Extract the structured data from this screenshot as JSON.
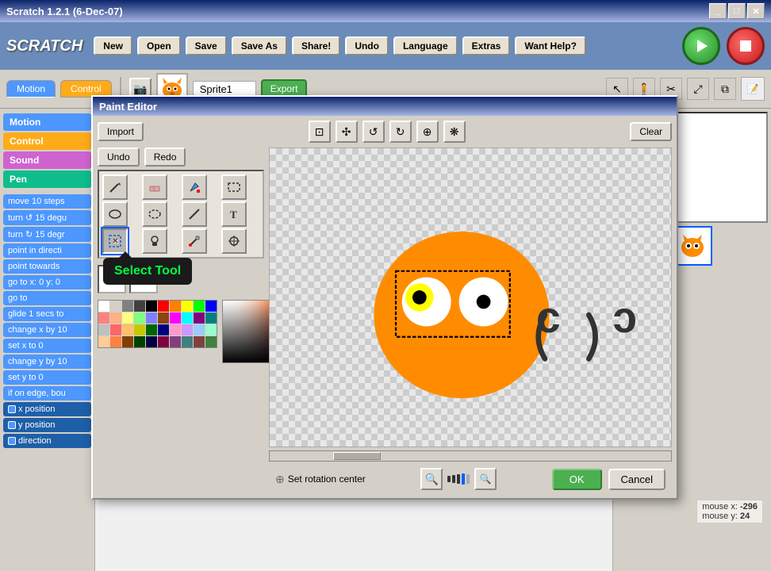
{
  "window": {
    "title": "Scratch 1.2.1 (6-Dec-07)",
    "controls": [
      "minimize",
      "maximize",
      "close"
    ]
  },
  "toolbar": {
    "logo": "SCRATCH",
    "buttons": [
      "New",
      "Open",
      "Save",
      "Save As",
      "Share!",
      "Undo",
      "Language",
      "Extras",
      "Want Help?"
    ]
  },
  "tabs": {
    "motion": "Motion",
    "control": "Control"
  },
  "sprite": {
    "name": "Sprite1",
    "export_label": "Export"
  },
  "categories": [
    "Motion",
    "Control",
    "Sound",
    "Pen"
  ],
  "blocks": [
    "move 10 steps",
    "turn ↺ 15 degu",
    "turn ↻ 15 degr",
    "point in directi",
    "point towards",
    "go to x: 0 y: 0",
    "go to",
    "glide 1 secs to",
    "change x by 10",
    "set x to 0",
    "change y by 10",
    "set y to 0",
    "if on edge, bou",
    "x position",
    "y position",
    "direction"
  ],
  "paint_editor": {
    "title": "Paint Editor",
    "import_btn": "Import",
    "undo_btn": "Undo",
    "redo_btn": "Redo",
    "clear_btn": "Clear",
    "ok_btn": "OK",
    "cancel_btn": "Cancel",
    "set_rotation_center": "Set rotation center",
    "tooltip": "Select Tool",
    "tools": [
      "pencil",
      "eraser",
      "fill",
      "rect-select",
      "ellipse",
      "select",
      "line",
      "text",
      "marquee",
      "stamp",
      "eyedropper"
    ],
    "zoom_levels": [
      "zoom-out",
      "zoom-1",
      "zoom-2",
      "zoom-3",
      "zoom-4",
      "zoom-5",
      "zoom-in"
    ]
  },
  "mouse": {
    "x_label": "mouse x:",
    "x_value": "-296",
    "y_label": "mouse y:",
    "y_value": "24"
  },
  "run_controls": {
    "green_flag": "▶",
    "stop": "■"
  },
  "color_palette": [
    "#ffffff",
    "#d4d0c8",
    "#808080",
    "#404040",
    "#000000",
    "#ff0000",
    "#ff8000",
    "#ffff00",
    "#00ff00",
    "#0000ff",
    "#ff8080",
    "#ffb080",
    "#ffff80",
    "#80ff80",
    "#8080ff",
    "#8b4513",
    "#ff00ff",
    "#00ffff",
    "#800080",
    "#008080",
    "#c0c0c0",
    "#ff6666",
    "#ffc066",
    "#c8c800",
    "#006400",
    "#000080",
    "#ff99cc",
    "#cc99ff",
    "#99ccff",
    "#99ffcc",
    "#ffcc99",
    "#ff8040",
    "#804000",
    "#004000",
    "#000040",
    "#800040",
    "#804080",
    "#408080",
    "#804040",
    "#408040"
  ]
}
